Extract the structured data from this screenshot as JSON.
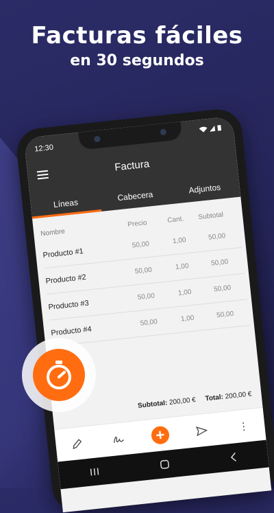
{
  "headline": {
    "line1": "Facturas fáciles",
    "line2": "en 30 segundos"
  },
  "status": {
    "time": "12:30"
  },
  "app": {
    "title": "Factura",
    "tabs": [
      {
        "label": "Líneas",
        "active": true
      },
      {
        "label": "Cabecera",
        "active": false
      },
      {
        "label": "Adjuntos",
        "active": false
      }
    ],
    "table": {
      "headers": {
        "name": "Nombre",
        "price": "Precio",
        "qty": "Cant.",
        "subtotal": "Subtotal"
      },
      "rows": [
        {
          "name": "Producto #1",
          "price": "50,00",
          "qty": "1,00",
          "subtotal": "50,00"
        },
        {
          "name": "Producto #2",
          "price": "50,00",
          "qty": "1,00",
          "subtotal": "50,00"
        },
        {
          "name": "Producto #3",
          "price": "50,00",
          "qty": "1,00",
          "subtotal": "50,00"
        },
        {
          "name": "Producto #4",
          "price": "50,00",
          "qty": "1,00",
          "subtotal": "50,00"
        }
      ]
    },
    "totals": {
      "subtotal_label": "Subtotal:",
      "subtotal_value": "200,00 €",
      "total_label": "Total:",
      "total_value": "200,00 €"
    },
    "bottom_icons": [
      "pencil-icon",
      "signature-icon",
      "add-icon",
      "send-icon",
      "more-vert-icon"
    ],
    "fab_label": "+",
    "more_label": "⋮"
  },
  "colors": {
    "accent": "#ff6d10",
    "appbar": "#333333",
    "background": "#26265c"
  }
}
